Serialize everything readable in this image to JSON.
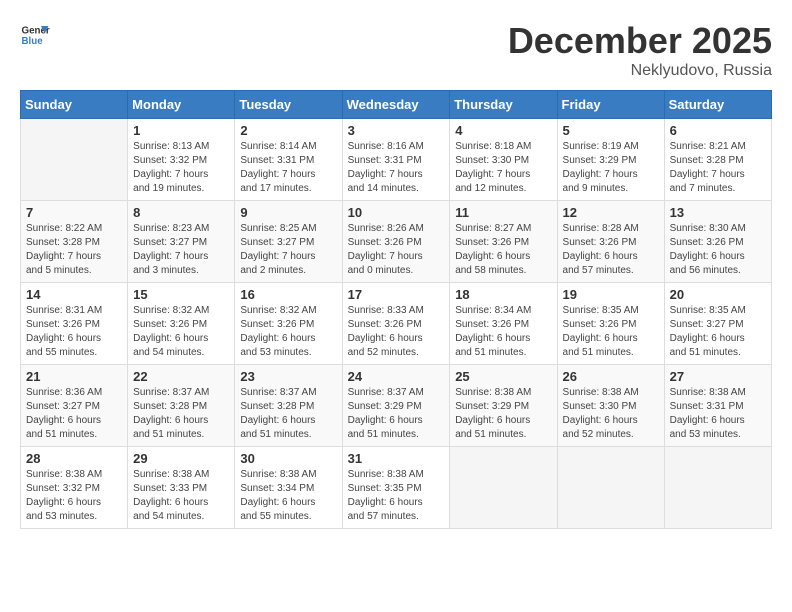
{
  "logo": {
    "line1": "General",
    "line2": "Blue"
  },
  "title": "December 2025",
  "subtitle": "Neklyudovo, Russia",
  "days_header": [
    "Sunday",
    "Monday",
    "Tuesday",
    "Wednesday",
    "Thursday",
    "Friday",
    "Saturday"
  ],
  "weeks": [
    [
      {
        "day": "",
        "info": ""
      },
      {
        "day": "1",
        "info": "Sunrise: 8:13 AM\nSunset: 3:32 PM\nDaylight: 7 hours\nand 19 minutes."
      },
      {
        "day": "2",
        "info": "Sunrise: 8:14 AM\nSunset: 3:31 PM\nDaylight: 7 hours\nand 17 minutes."
      },
      {
        "day": "3",
        "info": "Sunrise: 8:16 AM\nSunset: 3:31 PM\nDaylight: 7 hours\nand 14 minutes."
      },
      {
        "day": "4",
        "info": "Sunrise: 8:18 AM\nSunset: 3:30 PM\nDaylight: 7 hours\nand 12 minutes."
      },
      {
        "day": "5",
        "info": "Sunrise: 8:19 AM\nSunset: 3:29 PM\nDaylight: 7 hours\nand 9 minutes."
      },
      {
        "day": "6",
        "info": "Sunrise: 8:21 AM\nSunset: 3:28 PM\nDaylight: 7 hours\nand 7 minutes."
      }
    ],
    [
      {
        "day": "7",
        "info": "Sunrise: 8:22 AM\nSunset: 3:28 PM\nDaylight: 7 hours\nand 5 minutes."
      },
      {
        "day": "8",
        "info": "Sunrise: 8:23 AM\nSunset: 3:27 PM\nDaylight: 7 hours\nand 3 minutes."
      },
      {
        "day": "9",
        "info": "Sunrise: 8:25 AM\nSunset: 3:27 PM\nDaylight: 7 hours\nand 2 minutes."
      },
      {
        "day": "10",
        "info": "Sunrise: 8:26 AM\nSunset: 3:26 PM\nDaylight: 7 hours\nand 0 minutes."
      },
      {
        "day": "11",
        "info": "Sunrise: 8:27 AM\nSunset: 3:26 PM\nDaylight: 6 hours\nand 58 minutes."
      },
      {
        "day": "12",
        "info": "Sunrise: 8:28 AM\nSunset: 3:26 PM\nDaylight: 6 hours\nand 57 minutes."
      },
      {
        "day": "13",
        "info": "Sunrise: 8:30 AM\nSunset: 3:26 PM\nDaylight: 6 hours\nand 56 minutes."
      }
    ],
    [
      {
        "day": "14",
        "info": "Sunrise: 8:31 AM\nSunset: 3:26 PM\nDaylight: 6 hours\nand 55 minutes."
      },
      {
        "day": "15",
        "info": "Sunrise: 8:32 AM\nSunset: 3:26 PM\nDaylight: 6 hours\nand 54 minutes."
      },
      {
        "day": "16",
        "info": "Sunrise: 8:32 AM\nSunset: 3:26 PM\nDaylight: 6 hours\nand 53 minutes."
      },
      {
        "day": "17",
        "info": "Sunrise: 8:33 AM\nSunset: 3:26 PM\nDaylight: 6 hours\nand 52 minutes."
      },
      {
        "day": "18",
        "info": "Sunrise: 8:34 AM\nSunset: 3:26 PM\nDaylight: 6 hours\nand 51 minutes."
      },
      {
        "day": "19",
        "info": "Sunrise: 8:35 AM\nSunset: 3:26 PM\nDaylight: 6 hours\nand 51 minutes."
      },
      {
        "day": "20",
        "info": "Sunrise: 8:35 AM\nSunset: 3:27 PM\nDaylight: 6 hours\nand 51 minutes."
      }
    ],
    [
      {
        "day": "21",
        "info": "Sunrise: 8:36 AM\nSunset: 3:27 PM\nDaylight: 6 hours\nand 51 minutes."
      },
      {
        "day": "22",
        "info": "Sunrise: 8:37 AM\nSunset: 3:28 PM\nDaylight: 6 hours\nand 51 minutes."
      },
      {
        "day": "23",
        "info": "Sunrise: 8:37 AM\nSunset: 3:28 PM\nDaylight: 6 hours\nand 51 minutes."
      },
      {
        "day": "24",
        "info": "Sunrise: 8:37 AM\nSunset: 3:29 PM\nDaylight: 6 hours\nand 51 minutes."
      },
      {
        "day": "25",
        "info": "Sunrise: 8:38 AM\nSunset: 3:29 PM\nDaylight: 6 hours\nand 51 minutes."
      },
      {
        "day": "26",
        "info": "Sunrise: 8:38 AM\nSunset: 3:30 PM\nDaylight: 6 hours\nand 52 minutes."
      },
      {
        "day": "27",
        "info": "Sunrise: 8:38 AM\nSunset: 3:31 PM\nDaylight: 6 hours\nand 53 minutes."
      }
    ],
    [
      {
        "day": "28",
        "info": "Sunrise: 8:38 AM\nSunset: 3:32 PM\nDaylight: 6 hours\nand 53 minutes."
      },
      {
        "day": "29",
        "info": "Sunrise: 8:38 AM\nSunset: 3:33 PM\nDaylight: 6 hours\nand 54 minutes."
      },
      {
        "day": "30",
        "info": "Sunrise: 8:38 AM\nSunset: 3:34 PM\nDaylight: 6 hours\nand 55 minutes."
      },
      {
        "day": "31",
        "info": "Sunrise: 8:38 AM\nSunset: 3:35 PM\nDaylight: 6 hours\nand 57 minutes."
      },
      {
        "day": "",
        "info": ""
      },
      {
        "day": "",
        "info": ""
      },
      {
        "day": "",
        "info": ""
      }
    ]
  ]
}
